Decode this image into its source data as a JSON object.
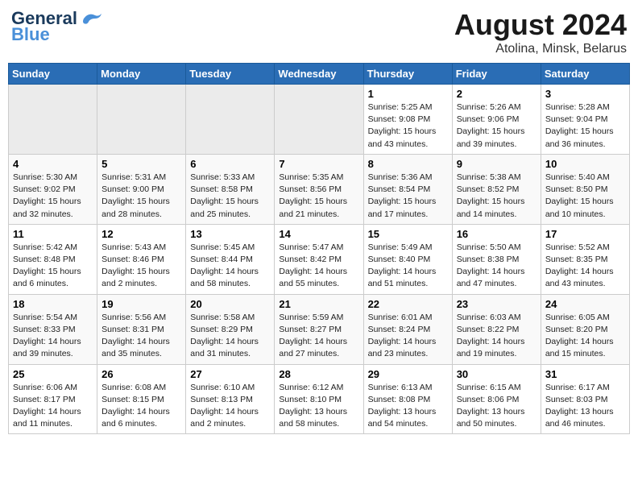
{
  "header": {
    "logo_general": "General",
    "logo_blue": "Blue",
    "title": "August 2024",
    "subtitle": "Atolina, Minsk, Belarus"
  },
  "days_of_week": [
    "Sunday",
    "Monday",
    "Tuesday",
    "Wednesday",
    "Thursday",
    "Friday",
    "Saturday"
  ],
  "weeks": [
    [
      {
        "day": "",
        "info": ""
      },
      {
        "day": "",
        "info": ""
      },
      {
        "day": "",
        "info": ""
      },
      {
        "day": "",
        "info": ""
      },
      {
        "day": "1",
        "info": "Sunrise: 5:25 AM\nSunset: 9:08 PM\nDaylight: 15 hours\nand 43 minutes."
      },
      {
        "day": "2",
        "info": "Sunrise: 5:26 AM\nSunset: 9:06 PM\nDaylight: 15 hours\nand 39 minutes."
      },
      {
        "day": "3",
        "info": "Sunrise: 5:28 AM\nSunset: 9:04 PM\nDaylight: 15 hours\nand 36 minutes."
      }
    ],
    [
      {
        "day": "4",
        "info": "Sunrise: 5:30 AM\nSunset: 9:02 PM\nDaylight: 15 hours\nand 32 minutes."
      },
      {
        "day": "5",
        "info": "Sunrise: 5:31 AM\nSunset: 9:00 PM\nDaylight: 15 hours\nand 28 minutes."
      },
      {
        "day": "6",
        "info": "Sunrise: 5:33 AM\nSunset: 8:58 PM\nDaylight: 15 hours\nand 25 minutes."
      },
      {
        "day": "7",
        "info": "Sunrise: 5:35 AM\nSunset: 8:56 PM\nDaylight: 15 hours\nand 21 minutes."
      },
      {
        "day": "8",
        "info": "Sunrise: 5:36 AM\nSunset: 8:54 PM\nDaylight: 15 hours\nand 17 minutes."
      },
      {
        "day": "9",
        "info": "Sunrise: 5:38 AM\nSunset: 8:52 PM\nDaylight: 15 hours\nand 14 minutes."
      },
      {
        "day": "10",
        "info": "Sunrise: 5:40 AM\nSunset: 8:50 PM\nDaylight: 15 hours\nand 10 minutes."
      }
    ],
    [
      {
        "day": "11",
        "info": "Sunrise: 5:42 AM\nSunset: 8:48 PM\nDaylight: 15 hours\nand 6 minutes."
      },
      {
        "day": "12",
        "info": "Sunrise: 5:43 AM\nSunset: 8:46 PM\nDaylight: 15 hours\nand 2 minutes."
      },
      {
        "day": "13",
        "info": "Sunrise: 5:45 AM\nSunset: 8:44 PM\nDaylight: 14 hours\nand 58 minutes."
      },
      {
        "day": "14",
        "info": "Sunrise: 5:47 AM\nSunset: 8:42 PM\nDaylight: 14 hours\nand 55 minutes."
      },
      {
        "day": "15",
        "info": "Sunrise: 5:49 AM\nSunset: 8:40 PM\nDaylight: 14 hours\nand 51 minutes."
      },
      {
        "day": "16",
        "info": "Sunrise: 5:50 AM\nSunset: 8:38 PM\nDaylight: 14 hours\nand 47 minutes."
      },
      {
        "day": "17",
        "info": "Sunrise: 5:52 AM\nSunset: 8:35 PM\nDaylight: 14 hours\nand 43 minutes."
      }
    ],
    [
      {
        "day": "18",
        "info": "Sunrise: 5:54 AM\nSunset: 8:33 PM\nDaylight: 14 hours\nand 39 minutes."
      },
      {
        "day": "19",
        "info": "Sunrise: 5:56 AM\nSunset: 8:31 PM\nDaylight: 14 hours\nand 35 minutes."
      },
      {
        "day": "20",
        "info": "Sunrise: 5:58 AM\nSunset: 8:29 PM\nDaylight: 14 hours\nand 31 minutes."
      },
      {
        "day": "21",
        "info": "Sunrise: 5:59 AM\nSunset: 8:27 PM\nDaylight: 14 hours\nand 27 minutes."
      },
      {
        "day": "22",
        "info": "Sunrise: 6:01 AM\nSunset: 8:24 PM\nDaylight: 14 hours\nand 23 minutes."
      },
      {
        "day": "23",
        "info": "Sunrise: 6:03 AM\nSunset: 8:22 PM\nDaylight: 14 hours\nand 19 minutes."
      },
      {
        "day": "24",
        "info": "Sunrise: 6:05 AM\nSunset: 8:20 PM\nDaylight: 14 hours\nand 15 minutes."
      }
    ],
    [
      {
        "day": "25",
        "info": "Sunrise: 6:06 AM\nSunset: 8:17 PM\nDaylight: 14 hours\nand 11 minutes."
      },
      {
        "day": "26",
        "info": "Sunrise: 6:08 AM\nSunset: 8:15 PM\nDaylight: 14 hours\nand 6 minutes."
      },
      {
        "day": "27",
        "info": "Sunrise: 6:10 AM\nSunset: 8:13 PM\nDaylight: 14 hours\nand 2 minutes."
      },
      {
        "day": "28",
        "info": "Sunrise: 6:12 AM\nSunset: 8:10 PM\nDaylight: 13 hours\nand 58 minutes."
      },
      {
        "day": "29",
        "info": "Sunrise: 6:13 AM\nSunset: 8:08 PM\nDaylight: 13 hours\nand 54 minutes."
      },
      {
        "day": "30",
        "info": "Sunrise: 6:15 AM\nSunset: 8:06 PM\nDaylight: 13 hours\nand 50 minutes."
      },
      {
        "day": "31",
        "info": "Sunrise: 6:17 AM\nSunset: 8:03 PM\nDaylight: 13 hours\nand 46 minutes."
      }
    ]
  ]
}
